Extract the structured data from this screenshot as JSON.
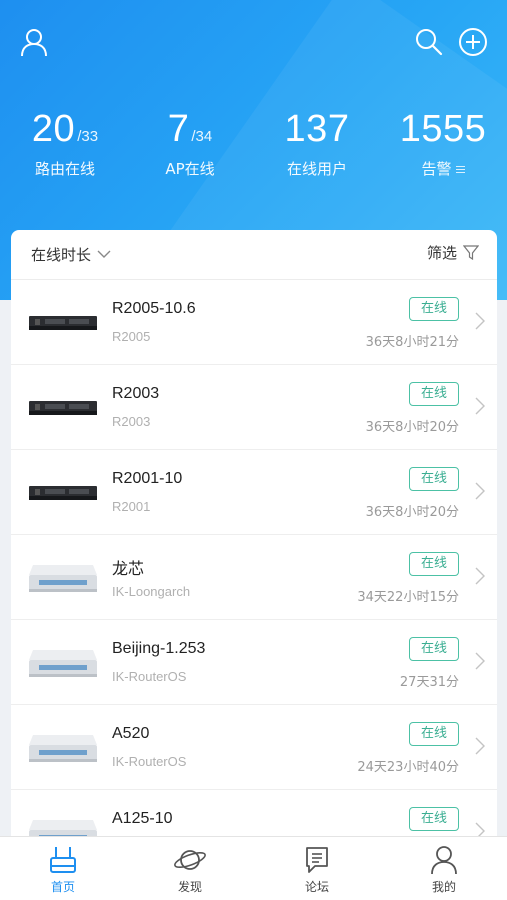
{
  "header": {
    "icons": {
      "profile": "user-icon",
      "search": "search-icon",
      "add": "add-circle-icon"
    }
  },
  "stats": [
    {
      "value": "20",
      "total": "/33",
      "label": "路由在线"
    },
    {
      "value": "7",
      "total": "/34",
      "label": "AP在线"
    },
    {
      "value": "137",
      "total": "",
      "label": "在线用户"
    },
    {
      "value": "1555",
      "total": "",
      "label": "告警"
    }
  ],
  "list_header": {
    "sort_label": "在线时长",
    "filter_label": "筛选"
  },
  "devices": [
    {
      "name": "R2005-10.6",
      "model": "R2005",
      "status": "在线",
      "duration": "36天8小时21分",
      "kind": "rack"
    },
    {
      "name": "R2003",
      "model": "R2003",
      "status": "在线",
      "duration": "36天8小时20分",
      "kind": "rack"
    },
    {
      "name": "R2001-10",
      "model": "R2001",
      "status": "在线",
      "duration": "36天8小时20分",
      "kind": "rack"
    },
    {
      "name": "龙芯",
      "model": "IK-Loongarch",
      "status": "在线",
      "duration": "34天22小时15分",
      "kind": "box"
    },
    {
      "name": "Beijing-1.253",
      "model": "IK-RouterOS",
      "status": "在线",
      "duration": "27天31分",
      "kind": "box"
    },
    {
      "name": "A520",
      "model": "IK-RouterOS",
      "status": "在线",
      "duration": "24天23小时40分",
      "kind": "box"
    },
    {
      "name": "A125-10",
      "model": "",
      "status": "在线",
      "duration": "",
      "kind": "box"
    }
  ],
  "tabs": [
    {
      "label": "首页",
      "icon": "router-icon",
      "active": true
    },
    {
      "label": "发现",
      "icon": "planet-icon",
      "active": false
    },
    {
      "label": "论坛",
      "icon": "forum-icon",
      "active": false
    },
    {
      "label": "我的",
      "icon": "user-icon",
      "active": false
    }
  ],
  "colors": {
    "primary": "#1e8ff0",
    "online_badge": "#3aae92"
  }
}
